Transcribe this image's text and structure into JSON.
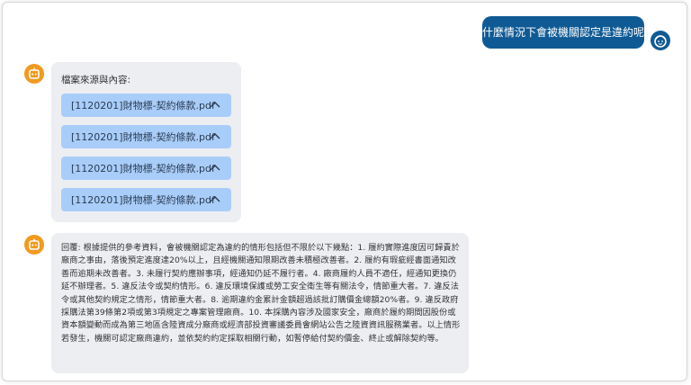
{
  "conversation": {
    "user_question": "什麼情況下會被機關認定是違約呢?",
    "sources_label": "檔案來源與內容:",
    "source_files": [
      "[1120201]財物標-契約條款.pdf",
      "[1120201]財物標-契約條款.pdf",
      "[1120201]財物標-契約條款.pdf",
      "[1120201]財物標-契約條款.pdf"
    ],
    "answer": "回覆: 根據提供的參考資料，會被機關認定為違約的情形包括但不限於以下幾點：1. 履約實際進度因可歸責於廠商之事由，落後預定進度達20%以上，且經機關通知限期改善未積極改善者。2. 履約有瑕疵經書面通知改善而逾期未改善者。3. 未履行契約應辦事項，經通知仍延不履行者。4. 廠商履約人員不適任，經通知更換仍延不辦理者。5. 違反法令或契約情形。6. 違反環境保護或勞工安全衛生等有關法令，情節重大者。7. 違反法令或其他契約規定之情形，情節重大者。8. 逾期違約金累計金額超過該批訂購價金總額20%者。9. 違反政府採購法第39條第2項或第3項規定之專案管理廠商。10. 本採購內容涉及國家安全，廠商於履約期間因股份或資本額變動而成為第三地區含陸資成分廠商或經濟部投資審議委員會網站公告之陸資資訊服務業者。以上情形若發生，機關可認定廠商違約，並依契約約定採取相關行動，如暫停給付契約價金、終止或解除契約等。"
  },
  "colors": {
    "user_bubble": "#0f5a94",
    "bot_avatar": "#f29a1f",
    "bot_bubble": "#eceef2",
    "file_chip": "#a9cdf9"
  },
  "icons": {
    "user_avatar": "user-face-icon",
    "bot_avatar": "robot-icon",
    "chip_toggle": "chevron-up-icon"
  }
}
